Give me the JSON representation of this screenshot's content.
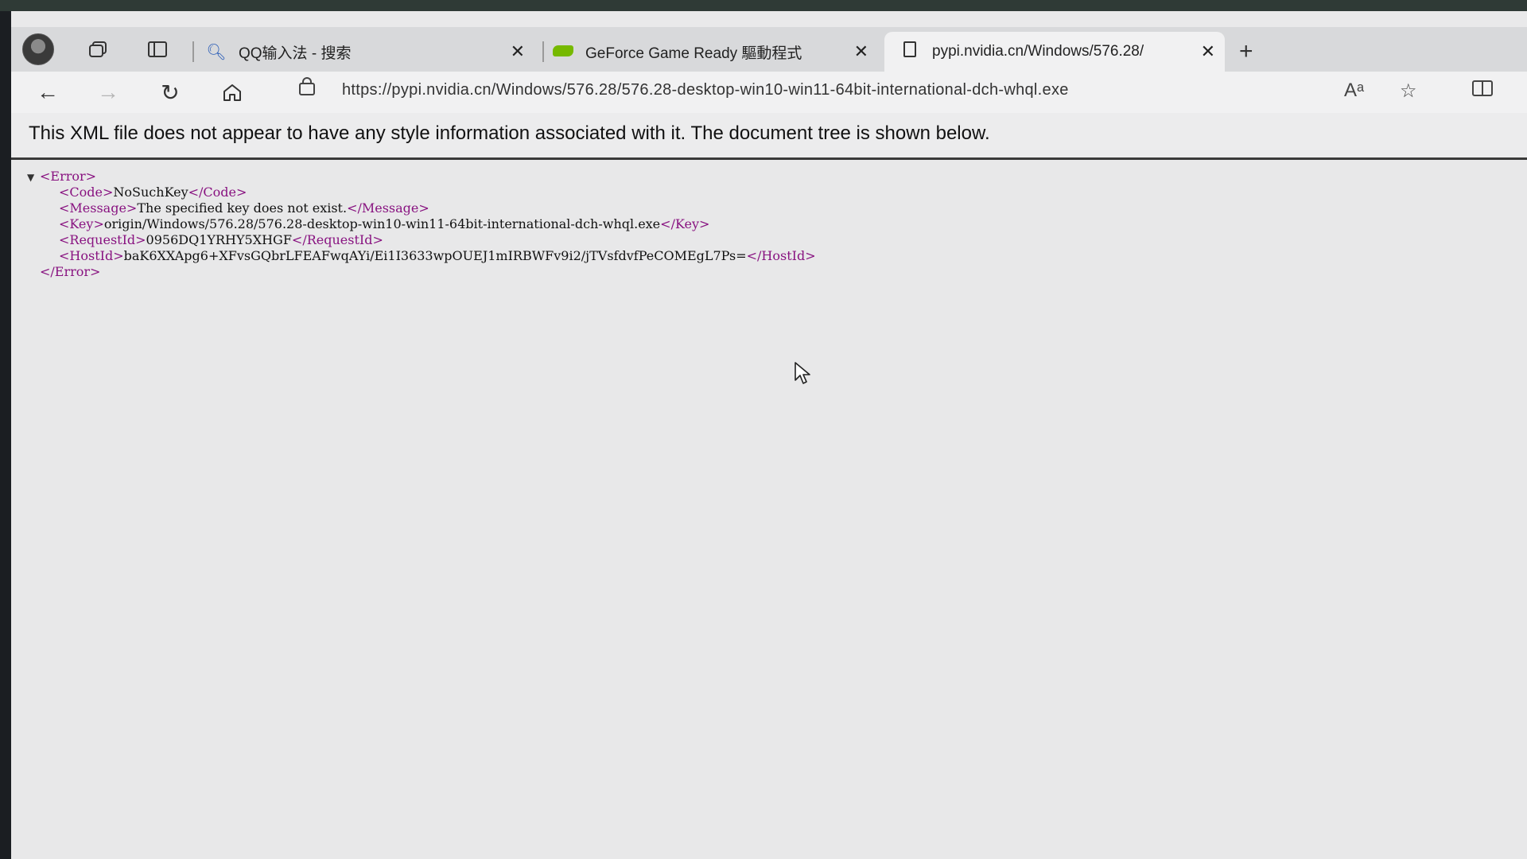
{
  "browser": {
    "tabs": [
      {
        "label": "QQ输入法 - 搜索",
        "icon": "search-icon"
      },
      {
        "label": "GeForce Game Ready 驅動程式",
        "icon": "nvidia-logo-icon"
      },
      {
        "label": "pypi.nvidia.cn/Windows/576.28/",
        "icon": "document-icon",
        "active": true
      }
    ],
    "new_tab_label": "+",
    "close_label": "✕",
    "address_url": "https://pypi.nvidia.cn/Windows/576.28/576.28-desktop-win10-win11-64bit-international-dch-whql.exe"
  },
  "page": {
    "banner": "This XML file does not appear to have any style information associated with it. The document tree is shown below.",
    "xml": {
      "root_open": "<Error>",
      "root_close": "</Error>",
      "lines": [
        {
          "open": "<Code>",
          "value": "NoSuchKey",
          "close": "</Code>"
        },
        {
          "open": "<Message>",
          "value": "The specified key does not exist.",
          "close": "</Message>"
        },
        {
          "open": "<Key>",
          "value": "origin/Windows/576.28/576.28-desktop-win10-win11-64bit-international-dch-whql.exe",
          "close": "</Key>"
        },
        {
          "open": "<RequestId>",
          "value": "0956DQ1YRHY5XHGF",
          "close": "</RequestId>"
        },
        {
          "open": "<HostId>",
          "value": "baK6XXApg6+XFvsGQbrLFEAFwqAYi/Ei1I3633wpOUEJ1mIRBWFv9i2/jTVsfdvfPeCOMEgL7Ps=",
          "close": "</HostId>"
        }
      ]
    }
  },
  "colors": {
    "tag": "#881280",
    "accent_nvidia": "#76b900"
  }
}
